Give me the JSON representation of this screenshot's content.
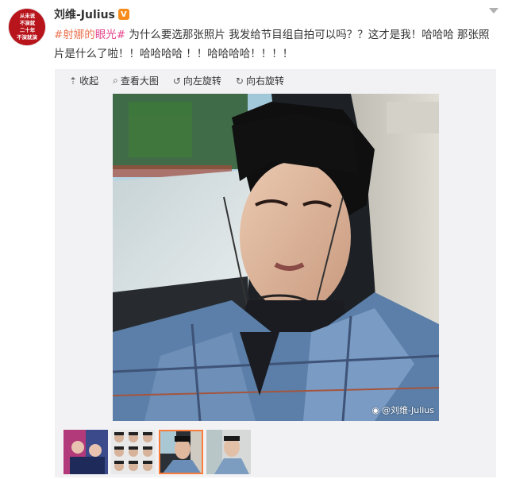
{
  "post": {
    "avatar_lines": [
      "从未说",
      "不演就",
      "二十年",
      "不演就演"
    ],
    "username": "刘维-Julius",
    "verified_badge": "V",
    "topic1": "#射娜的",
    "topic2": "眼光#",
    "text": " 为什么要选那张照片 我发给节目组自拍可以吗？？这才是我！哈哈哈 那张照片是什么了啦！！哈哈哈哈 ！！哈哈哈哈！！！！"
  },
  "toolbar": {
    "collapse_label": "收起",
    "view_large_label": "查看大图",
    "rotate_left_label": "向左旋转",
    "rotate_right_label": "向右旋转"
  },
  "photo": {
    "watermark": "@刘维-Julius"
  },
  "thumbnails": [
    {
      "name": "thumb-1",
      "active": false
    },
    {
      "name": "thumb-2",
      "active": false
    },
    {
      "name": "thumb-3",
      "active": true
    },
    {
      "name": "thumb-4",
      "active": false
    }
  ],
  "colors": {
    "topic_orange": "#eb7350",
    "topic_pink": "#e6418b",
    "active_thumb_border": "#fa7d3c",
    "vip_badge": "#f78b1c"
  }
}
